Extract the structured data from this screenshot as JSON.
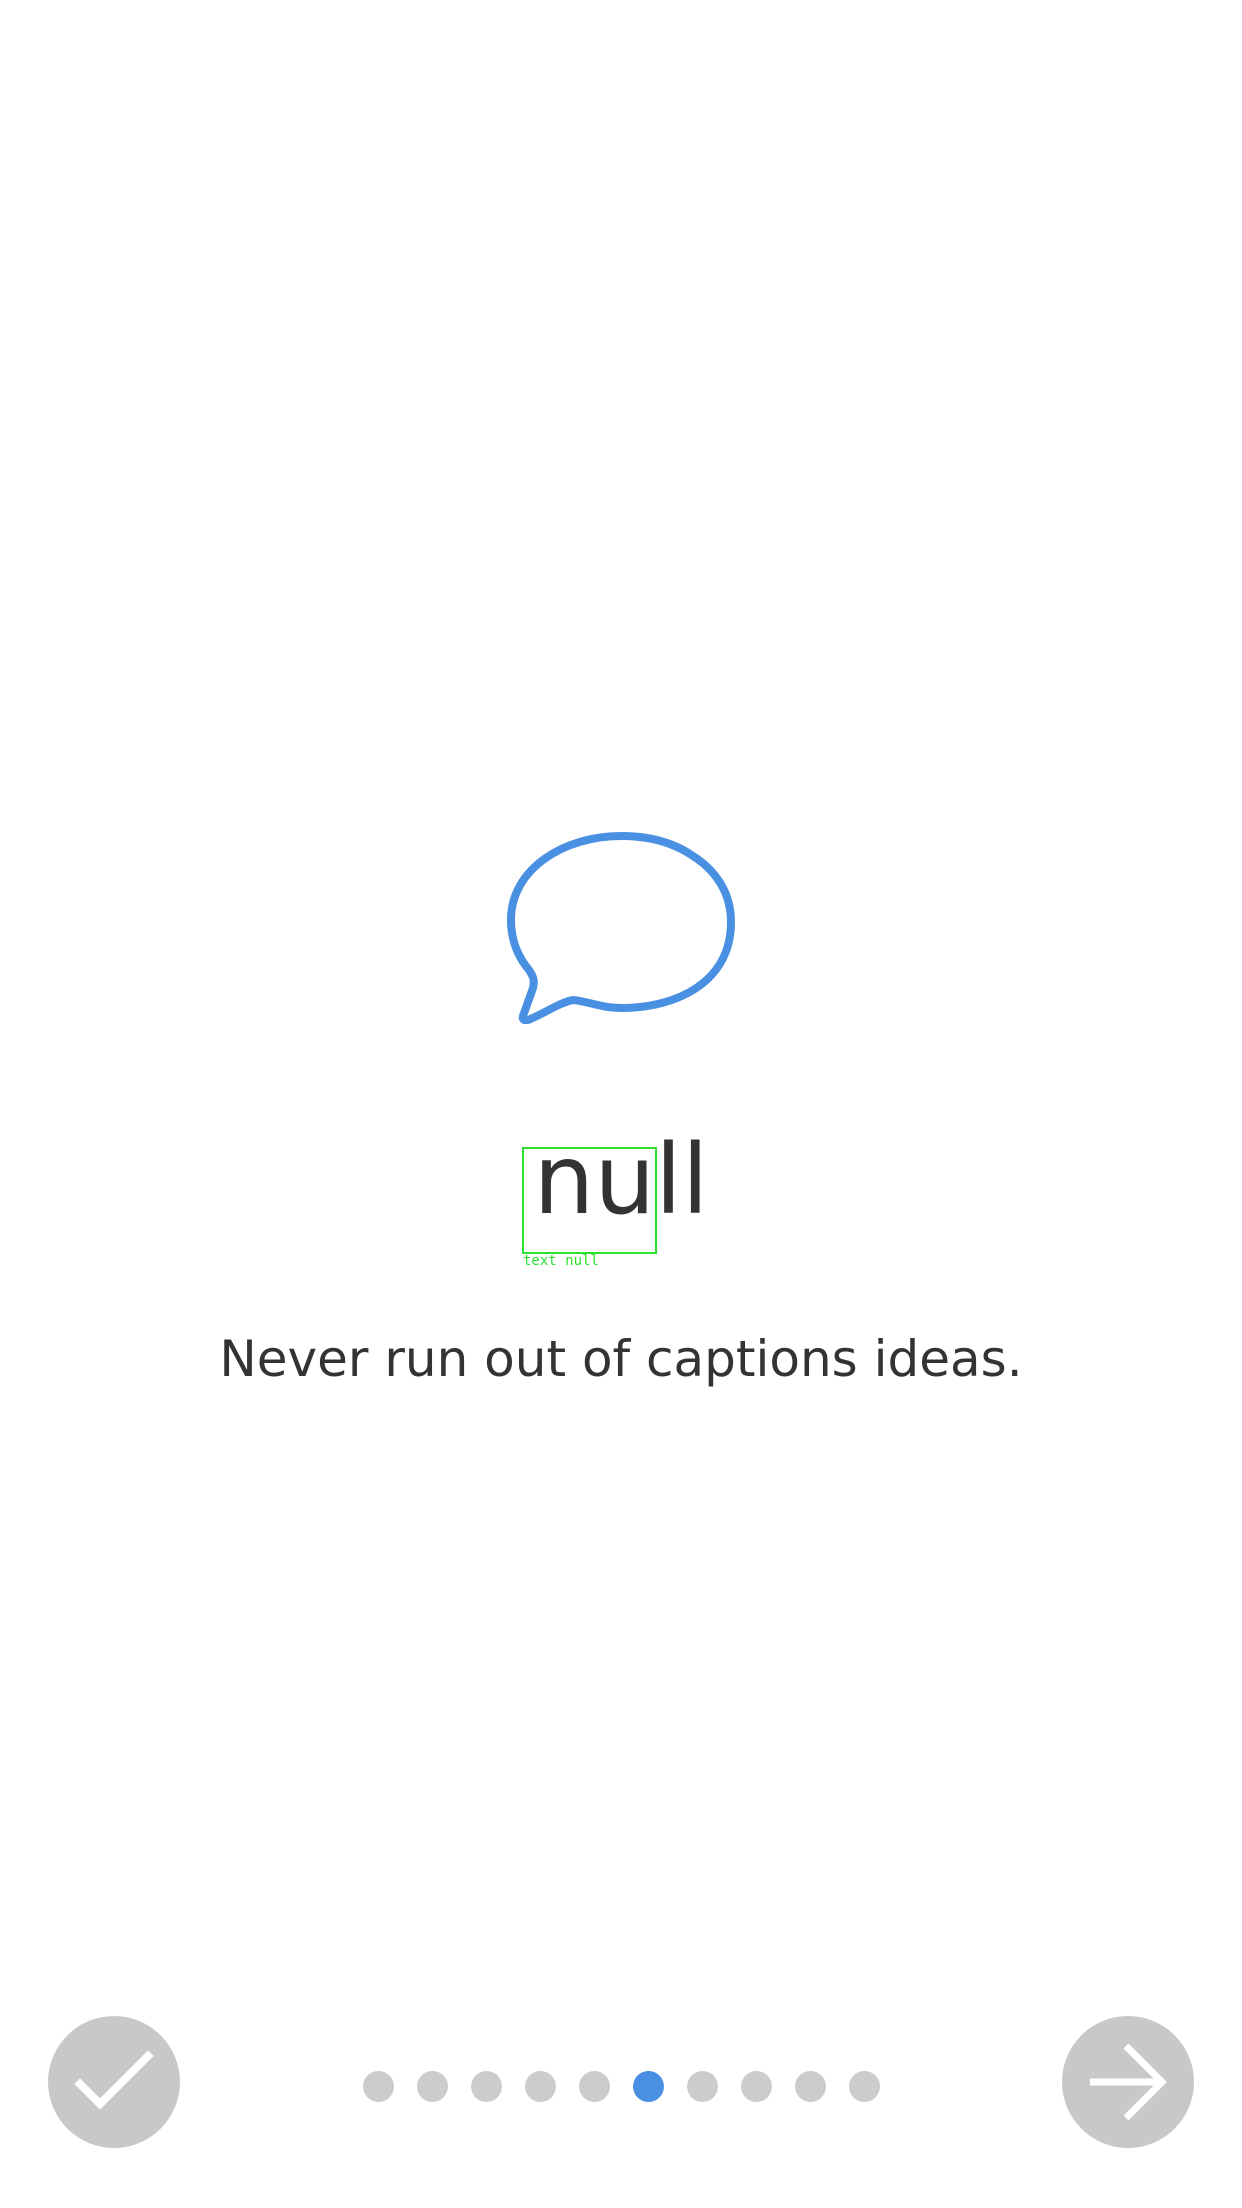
{
  "colors": {
    "accent": "#4a90e2",
    "text": "#333333",
    "button_bg": "#c8c8c8",
    "dot_inactive": "#cccccc",
    "debug": "#2ee02e"
  },
  "icon": {
    "name": "chat-bubble-icon"
  },
  "title": "null",
  "debug_label": "text null",
  "subtitle": "Never run out of captions ideas.",
  "done_button": {
    "icon": "checkmark-icon"
  },
  "next_button": {
    "icon": "arrow-right-icon"
  },
  "pagination": {
    "total": 10,
    "current": 6
  }
}
